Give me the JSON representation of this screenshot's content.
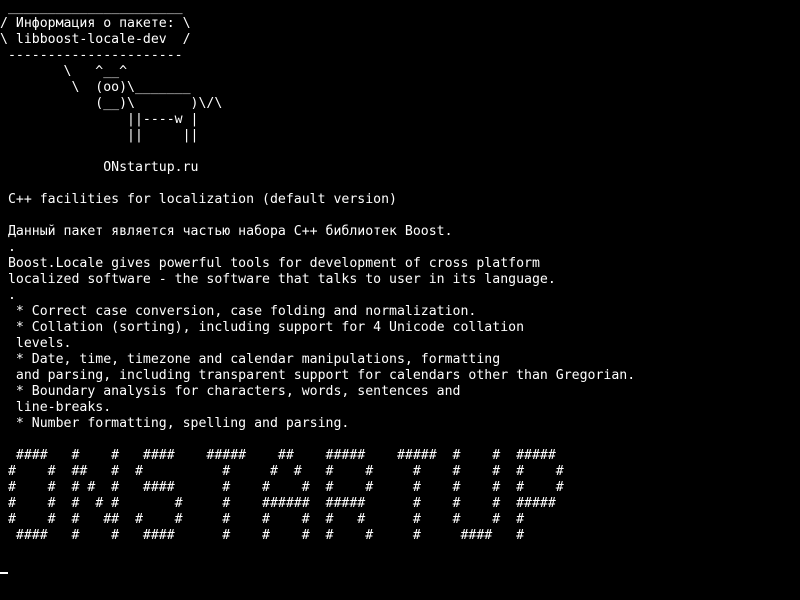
{
  "terminal": {
    "lines": [
      " ______________________",
      "/ Информация о пакете: \\",
      "\\ libboost-locale-dev  /",
      " ----------------------",
      "        \\   ^__^",
      "         \\  (oo)\\_______",
      "            (__)\\       )\\/\\",
      "                ||----w |",
      "                ||     ||",
      "",
      "             ONstartup.ru",
      "",
      " C++ facilities for localization (default version)",
      "",
      " Данный пакет является частью набора C++ библиотек Boost.",
      " .",
      " Boost.Locale gives powerful tools for development of cross platform",
      " localized software - the software that talks to user in its language.",
      " .",
      "  * Correct case conversion, case folding and normalization.",
      "  * Collation (sorting), including support for 4 Unicode collation",
      "  levels.",
      "  * Date, time, timezone and calendar manipulations, formatting",
      "  and parsing, including transparent support for calendars other than Gregorian.",
      "  * Boundary analysis for characters, words, sentences and",
      "  line-breaks.",
      "  * Number formatting, spelling and parsing.",
      "",
      "  ####   #    #   ####    #####    ##    #####    #####  #    #  #####",
      " #    #  ##   #  #          #     #  #   #    #     #    #    #  #    #",
      " #    #  # #  #   ####      #    #    #  #    #     #    #    #  #    #",
      " #    #  #  # #       #     #    ######  #####      #    #    #  #####",
      " #    #  #   ##  #    #     #    #    #  #   #      #    #    #  #",
      "  ####   #    #   ####      #    #    #  #    #     #     ####   #"
    ]
  }
}
